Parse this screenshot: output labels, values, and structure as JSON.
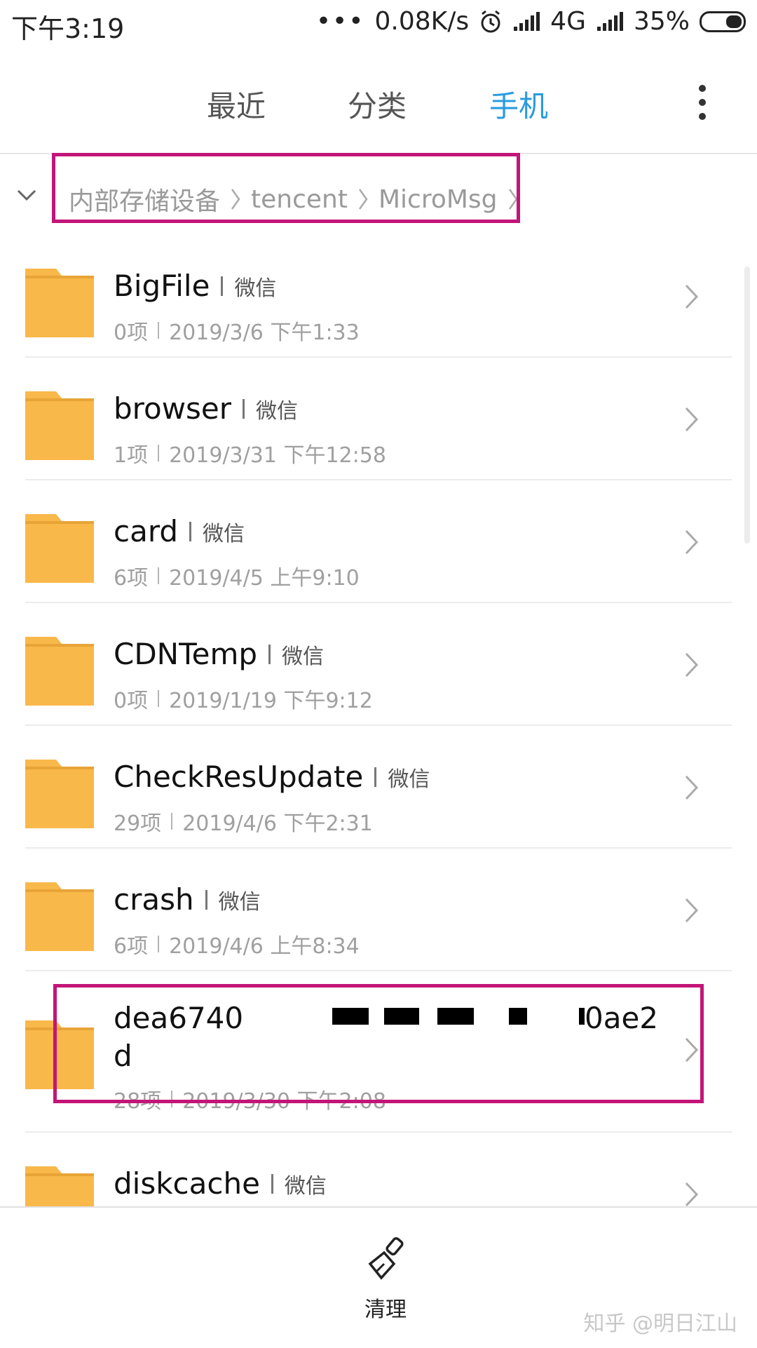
{
  "status_bar": {
    "time": "下午3:19",
    "network_speed": "0.08K/s",
    "network_type": "4G",
    "battery": "35%"
  },
  "tabs": [
    {
      "label": "最近",
      "active": false
    },
    {
      "label": "分类",
      "active": false
    },
    {
      "label": "手机",
      "active": true
    }
  ],
  "breadcrumb": [
    "内部存储设备",
    "tencent",
    "MicroMsg"
  ],
  "folders": [
    {
      "name": "BigFile",
      "tag": "微信",
      "count": "0项",
      "date": "2019/3/6 下午1:33"
    },
    {
      "name": "browser",
      "tag": "微信",
      "count": "1项",
      "date": "2019/3/31 下午12:58"
    },
    {
      "name": "card",
      "tag": "微信",
      "count": "6项",
      "date": "2019/4/5 上午9:10"
    },
    {
      "name": "CDNTemp",
      "tag": "微信",
      "count": "0项",
      "date": "2019/1/19 下午9:12"
    },
    {
      "name": "CheckResUpdate",
      "tag": "微信",
      "count": "29项",
      "date": "2019/4/6 下午2:31"
    },
    {
      "name": "crash",
      "tag": "微信",
      "count": "6项",
      "date": "2019/4/6 上午8:34"
    },
    {
      "name_start": "dea6740",
      "name_end": "0ae2",
      "name_line2": "d",
      "count": "28项",
      "date": "2019/3/30 下午2:08"
    },
    {
      "name": "diskcache",
      "tag": "微信"
    }
  ],
  "bottom": {
    "clean_label": "清理",
    "watermark": "知乎 @明日江山"
  },
  "colors": {
    "accent": "#2a9be0",
    "folder": "#f9b84a",
    "highlight": "#c31578"
  }
}
